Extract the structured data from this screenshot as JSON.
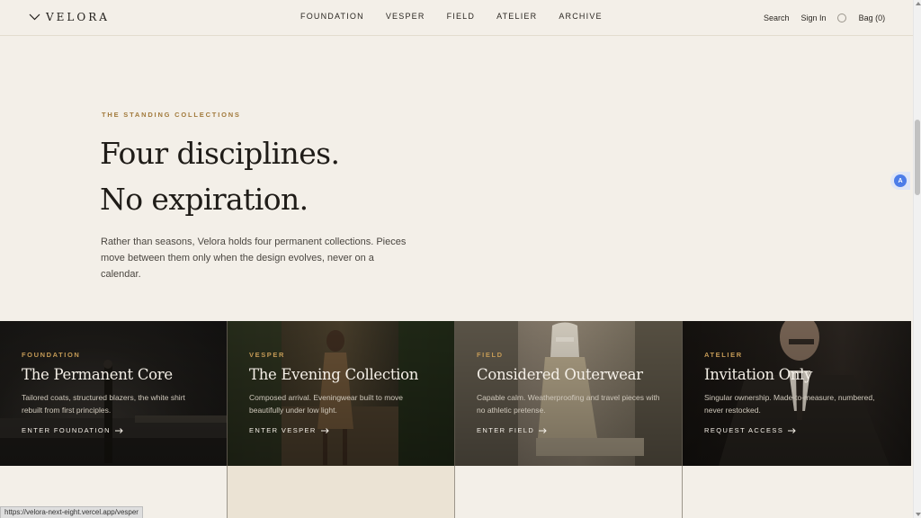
{
  "header": {
    "logo": "VELORA",
    "nav": [
      "FOUNDATION",
      "VESPER",
      "FIELD",
      "ATELIER",
      "ARCHIVE"
    ],
    "search": "Search",
    "sign_in": "Sign In",
    "bag": "Bag (0)"
  },
  "hero": {
    "eyebrow": "THE STANDING COLLECTIONS",
    "headline_1": "Four disciplines.",
    "headline_2": "No expiration.",
    "intro": "Rather than seasons, Velora holds four permanent collections. Pieces move between them only when the design evolves, never on a calendar."
  },
  "collections": [
    {
      "eyebrow": "FOUNDATION",
      "title": "The Permanent Core",
      "description": "Tailored coats, structured blazers, the white shirt rebuilt from first principles.",
      "cta": "ENTER FOUNDATION"
    },
    {
      "eyebrow": "VESPER",
      "title": "The Evening Collection",
      "description": "Composed arrival. Eveningwear built to move beautifully under low light.",
      "cta": "ENTER VESPER"
    },
    {
      "eyebrow": "FIELD",
      "title": "Considered Outerwear",
      "description": "Capable calm. Weatherproofing and travel pieces with no athletic pretense.",
      "cta": "ENTER FIELD"
    },
    {
      "eyebrow": "ATELIER",
      "title": "Invitation Only",
      "description": "Singular ownership. Made-to-measure, numbered, never restocked.",
      "cta": "REQUEST ACCESS"
    }
  ],
  "status_url": "https://velora-next-eight.vercel.app/vesper",
  "colors": {
    "accent": "#a27a3c",
    "background": "#f3efe8",
    "card_eyebrow": "#c49a56"
  },
  "icons": {
    "logo": "chevron-logo-icon",
    "account": "circle-icon",
    "cta": "arrow-right-icon",
    "translate": "translate-icon"
  }
}
